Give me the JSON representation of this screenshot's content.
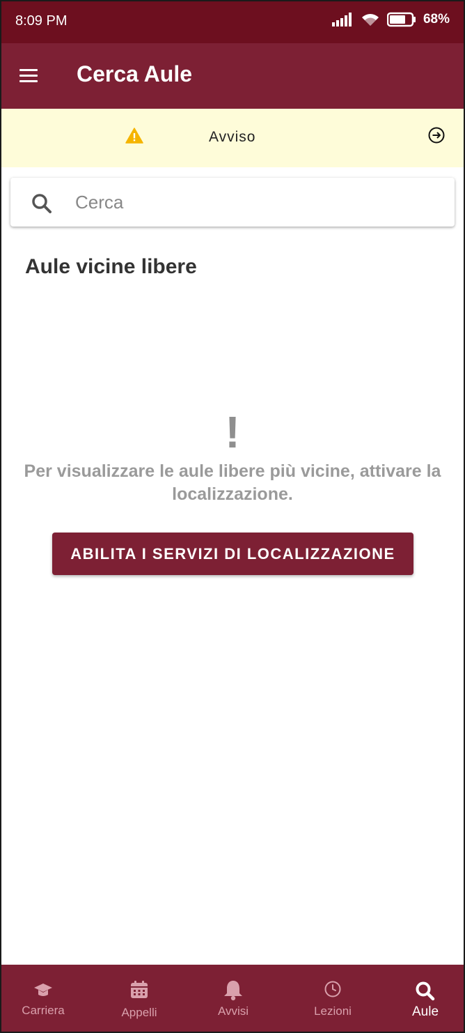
{
  "status_bar": {
    "time": "8:09 PM",
    "battery": "68%"
  },
  "app_bar": {
    "title": "Cerca Aule",
    "menu_icon": "hamburger-menu-icon"
  },
  "notice": {
    "label": "Avviso",
    "icon": "warning-icon",
    "action_icon": "arrow-right-circle-icon"
  },
  "search": {
    "placeholder": "Cerca",
    "value": ""
  },
  "section": {
    "title": "Aule vicine libere"
  },
  "empty_state": {
    "icon": "!",
    "message": "Per visualizzare le aule libere più vicine, attivare la localizzazione.",
    "button_label": "ABILITA I SERVIZI DI LOCALIZZAZIONE"
  },
  "bottom_nav": {
    "items": [
      {
        "label": "Carriera",
        "icon": "graduation-cap-icon"
      },
      {
        "label": "Appelli",
        "icon": "calendar-icon"
      },
      {
        "label": "Avvisi",
        "icon": "bell-icon"
      },
      {
        "label": "Lezioni",
        "icon": "clock-icon"
      },
      {
        "label": "Aule",
        "icon": "search-icon",
        "active": true
      }
    ]
  },
  "colors": {
    "status_bar": "#6d0f1f",
    "primary": "#7d2034",
    "notice_bg": "#fefcd9",
    "warning": "#f5b400",
    "nav_inactive": "#d9a0ac"
  }
}
